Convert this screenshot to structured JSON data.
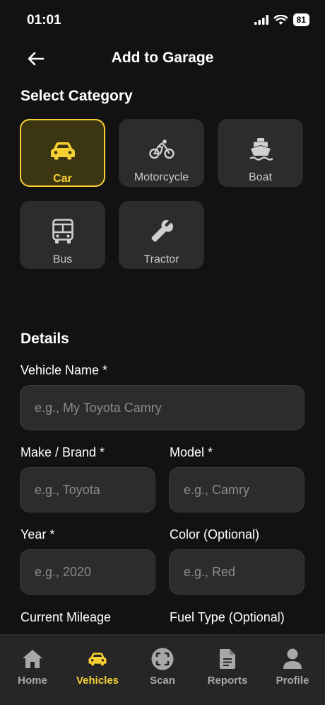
{
  "status": {
    "time": "01:01",
    "battery": "81"
  },
  "header": {
    "title": "Add to Garage"
  },
  "category_section": {
    "title": "Select Category",
    "items": [
      {
        "label": "Car",
        "icon": "car-icon",
        "selected": true
      },
      {
        "label": "Motorcycle",
        "icon": "bicycle-icon",
        "selected": false
      },
      {
        "label": "Boat",
        "icon": "boat-icon",
        "selected": false
      },
      {
        "label": "Bus",
        "icon": "bus-icon",
        "selected": false
      },
      {
        "label": "Tractor",
        "icon": "wrench-icon",
        "selected": false
      }
    ]
  },
  "details": {
    "title": "Details",
    "vehicle_name": {
      "label": "Vehicle Name *",
      "placeholder": "e.g., My Toyota Camry"
    },
    "make": {
      "label": "Make / Brand *",
      "placeholder": "e.g., Toyota"
    },
    "model": {
      "label": "Model *",
      "placeholder": "e.g., Camry"
    },
    "year": {
      "label": "Year *",
      "placeholder": "e.g., 2020"
    },
    "color": {
      "label": "Color (Optional)",
      "placeholder": "e.g., Red"
    },
    "mileage": {
      "label": "Current Mileage"
    },
    "fuel": {
      "label": "Fuel Type (Optional)"
    }
  },
  "tabs": [
    {
      "label": "Home",
      "icon": "home-icon",
      "active": false
    },
    {
      "label": "Vehicles",
      "icon": "car-icon",
      "active": true
    },
    {
      "label": "Scan",
      "icon": "scan-icon",
      "active": false
    },
    {
      "label": "Reports",
      "icon": "document-icon",
      "active": false
    },
    {
      "label": "Profile",
      "icon": "person-icon",
      "active": false
    }
  ],
  "colors": {
    "accent": "#f7d134",
    "background": "#121212",
    "surface": "#2c2c2c"
  }
}
